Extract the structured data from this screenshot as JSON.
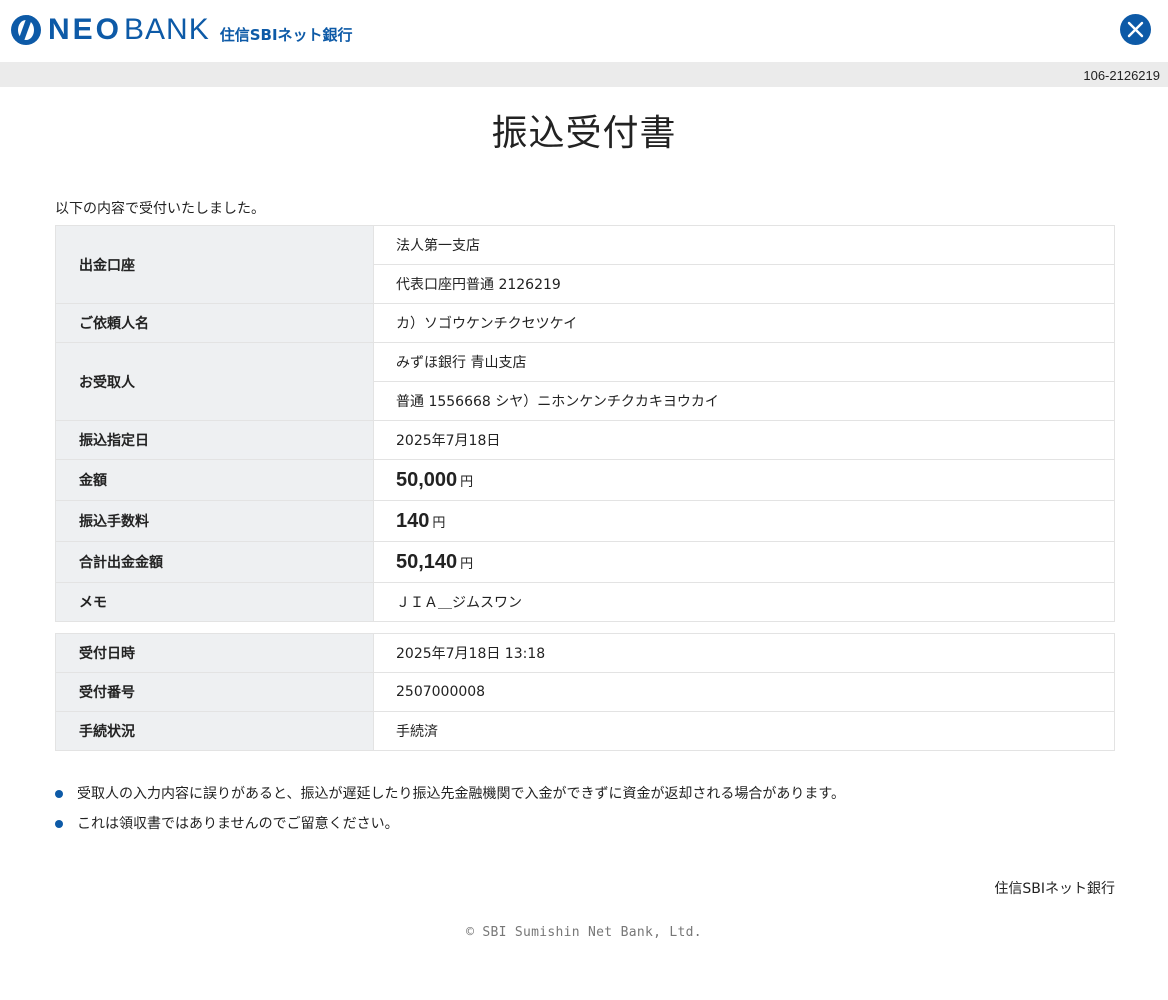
{
  "header": {
    "logo_neo": "NEO",
    "logo_bank": "BANK",
    "logo_sub": "住信SBIネット銀行",
    "close_label": "閉じる"
  },
  "account_no": "106-2126219",
  "title": "振込受付書",
  "intro": "以下の内容で受付いたしました。",
  "table1": {
    "withdrawal_label": "出金口座",
    "withdrawal_branch": "法人第一支店",
    "withdrawal_account": "代表口座円普通 2126219",
    "requester_label": "ご依頼人名",
    "requester_value": "カ）ソゴウケンチクセツケイ",
    "recipient_label": "お受取人",
    "recipient_bank": "みずほ銀行 青山支店",
    "recipient_account": "普通 1556668 シヤ）ニホンケンチクカキヨウカイ",
    "date_label": "振込指定日",
    "date_value": "2025年7月18日",
    "amount_label": "金額",
    "amount_value": "50,000",
    "fee_label": "振込手数料",
    "fee_value": "140",
    "total_label": "合計出金金額",
    "total_value": "50,140",
    "memo_label": "メモ",
    "memo_value": "ＪＩＡ＿ジムスワン",
    "yen": "円"
  },
  "table2": {
    "received_at_label": "受付日時",
    "received_at_value": "2025年7月18日 13:18",
    "receipt_no_label": "受付番号",
    "receipt_no_value": "2507000008",
    "status_label": "手続状況",
    "status_value": "手続済"
  },
  "notes": [
    "受取人の入力内容に誤りがあると、振込が遅延したり振込先金融機関で入金ができずに資金が返却される場合があります。",
    "これは領収書ではありませんのでご留意ください。"
  ],
  "bank_sign": "住信SBIネット銀行",
  "copyright": "© SBI Sumishin Net Bank, Ltd.",
  "colors": {
    "brand": "#0d5aa7",
    "label_bg": "#eef0f2",
    "subbar_bg": "#ebebeb"
  }
}
